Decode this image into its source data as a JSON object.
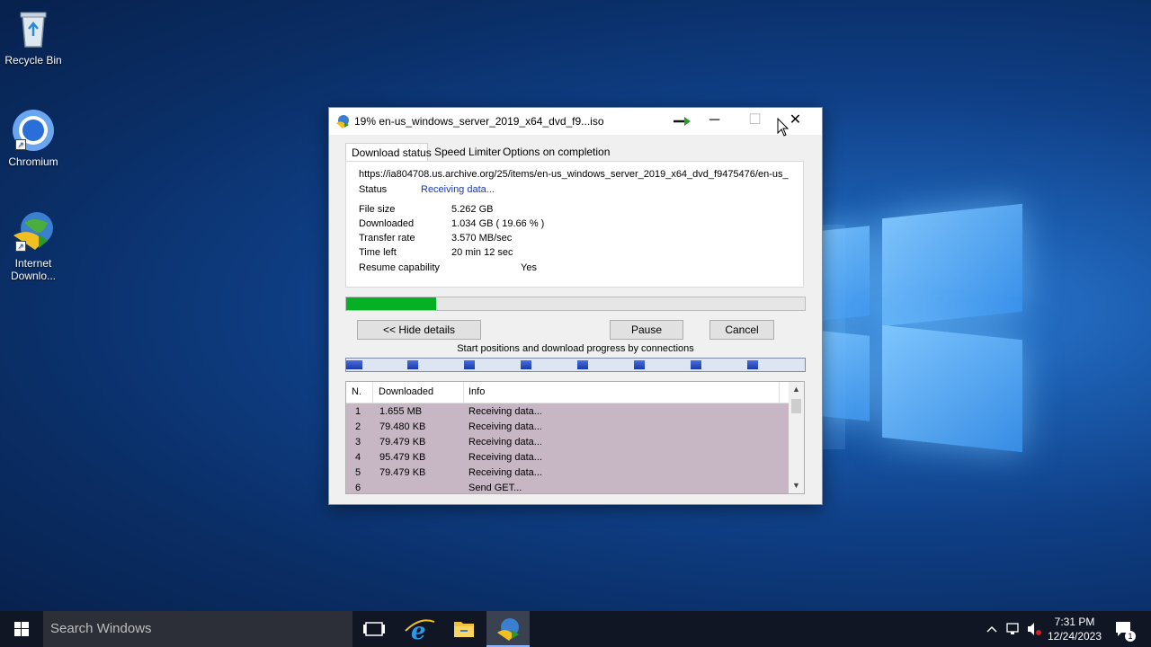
{
  "desktop": {
    "icons": [
      {
        "label": "Recycle Bin"
      },
      {
        "label": "Chromium"
      },
      {
        "label": "Internet Downlo..."
      }
    ]
  },
  "dialog": {
    "title": "19% en-us_windows_server_2019_x64_dvd_f9...iso",
    "tabs": [
      "Download status",
      "Speed Limiter",
      "Options on completion"
    ],
    "url": "https://ia804708.us.archive.org/25/items/en-us_windows_server_2019_x64_dvd_f9475476/en-us_",
    "status_label": "Status",
    "status_value": "Receiving data...",
    "file_size_label": "File size",
    "file_size": "5.262  GB",
    "downloaded_label": "Downloaded",
    "downloaded": "1.034  GB  ( 19.66 % )",
    "transfer_rate_label": "Transfer rate",
    "transfer_rate": "3.570  MB/sec",
    "time_left_label": "Time left",
    "time_left": "20 min 12 sec",
    "resume_label": "Resume capability",
    "resume": "Yes",
    "progress_percent": 19.66,
    "hide_details_label": "<< Hide details",
    "pause_label": "Pause",
    "cancel_label": "Cancel",
    "connections_label": "Start positions and download progress by connections",
    "table": {
      "headers": [
        "N.",
        "Downloaded",
        "Info"
      ],
      "rows": [
        {
          "n": "1",
          "downloaded": "1.655  MB",
          "info": "Receiving data..."
        },
        {
          "n": "2",
          "downloaded": "79.480  KB",
          "info": "Receiving data..."
        },
        {
          "n": "3",
          "downloaded": "79.479  KB",
          "info": "Receiving data..."
        },
        {
          "n": "4",
          "downloaded": "95.479  KB",
          "info": "Receiving data..."
        },
        {
          "n": "5",
          "downloaded": "79.479  KB",
          "info": "Receiving data..."
        },
        {
          "n": "6",
          "downloaded": "",
          "info": "Send GET..."
        }
      ]
    }
  },
  "taskbar": {
    "search_placeholder": "Search Windows",
    "time": "7:31 PM",
    "date": "12/24/2023",
    "notification_count": "1"
  },
  "colors": {
    "progress": "#06b025",
    "connection_segment": "#2a4bc8",
    "table_bg": "#c7b6c4"
  }
}
